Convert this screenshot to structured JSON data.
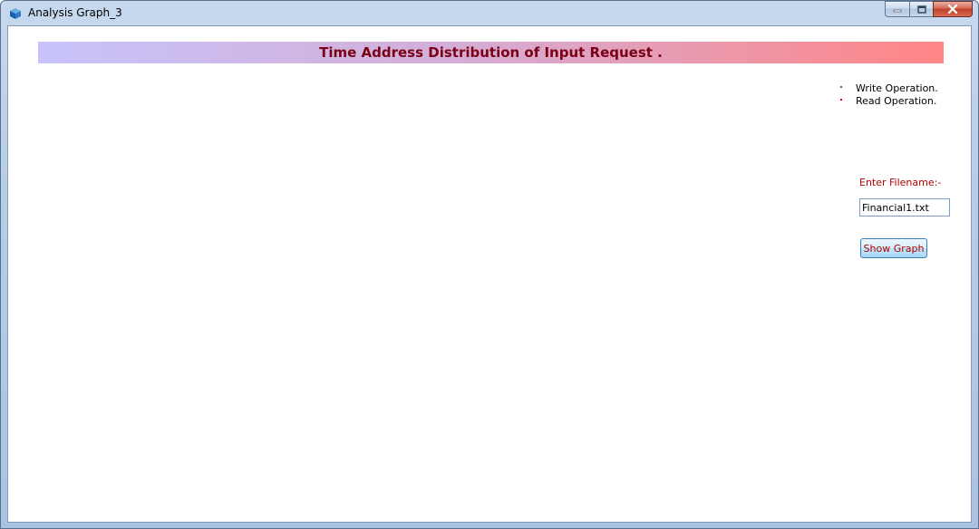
{
  "window": {
    "title": "Analysis Graph_3",
    "icon": "app-cube-icon",
    "caption_buttons": [
      "minimize-icon",
      "maximize-icon",
      "close-icon"
    ]
  },
  "banner": {
    "title": "Time Address Distribution of Input Request ."
  },
  "legend": {
    "items": [
      {
        "label": "Write Operation.",
        "color": "#00a000"
      },
      {
        "label": "Read Operation.",
        "color": "#ff0000"
      }
    ]
  },
  "form": {
    "filename_label": "Enter Filename:-",
    "filename_value": "Financial1.txt",
    "show_graph_label": "Show Graph"
  },
  "colors": {
    "banner_text": "#7a0015",
    "accent_red": "#b30000"
  }
}
